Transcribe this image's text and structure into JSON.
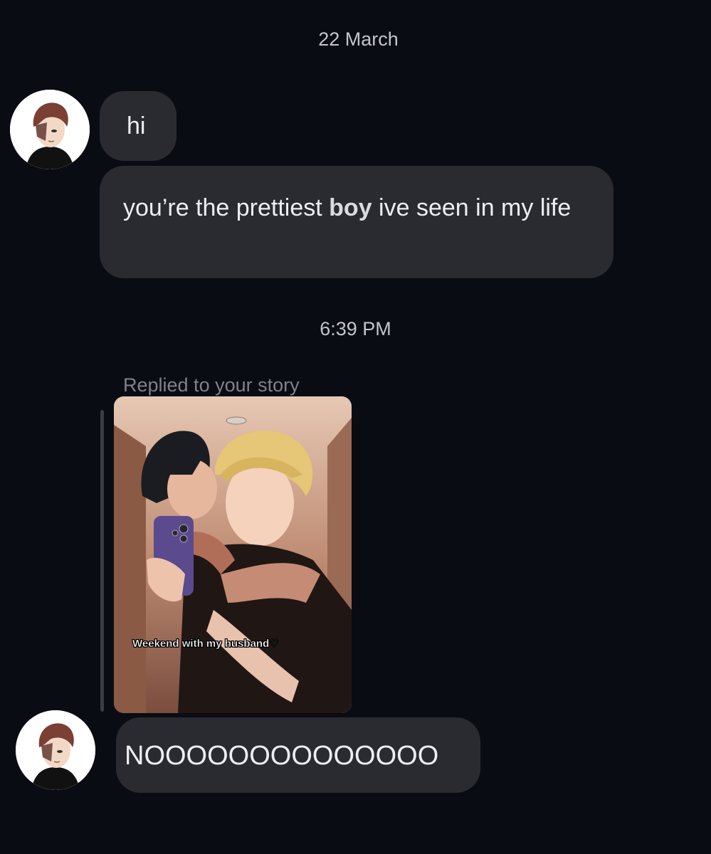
{
  "timestamps": {
    "date": "22 March",
    "time": "6:39 PM"
  },
  "messages": [
    {
      "text": "hi"
    },
    {
      "text_before": "you’re the prettiest ",
      "emphasis": "boy",
      "text_after": " ive seen in my life"
    },
    {
      "text": "NOOOOOOOOOOOOOO"
    }
  ],
  "story_reply": {
    "label": "Replied to your story",
    "caption": "Weekend with my husband♡"
  },
  "icons": {
    "avatar": "user-avatar-icon"
  },
  "colors": {
    "background": "#090c13",
    "bubble": "#2a2b31",
    "text": "#eceef2",
    "muted": "#7f828b"
  }
}
